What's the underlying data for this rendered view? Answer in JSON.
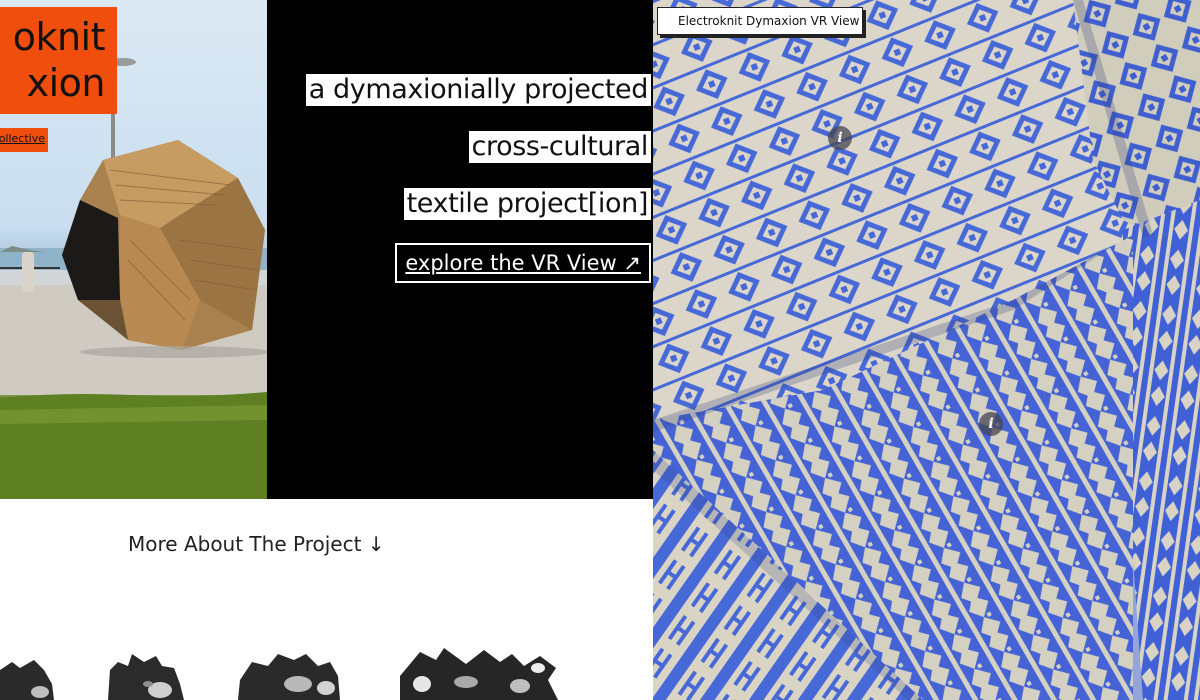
{
  "hero": {
    "title_line1": "oknit",
    "title_line2": "xion",
    "collective_link": "collective"
  },
  "statement": {
    "line1": "a dymaxionially projected",
    "line2": "cross-cultural",
    "line3": "textile project[ion]",
    "vr_link": "explore the VR View ↗"
  },
  "more_about": "More About The Project ↓",
  "vr_view": {
    "label": "Electroknit Dymaxion VR View",
    "hotspot_icon": "info-icon",
    "hotspot_glyph": "i"
  },
  "colors": {
    "accent": "#f04e0c",
    "panel_black": "#000000",
    "textile_blue": "#3a5fd6",
    "textile_cream": "#d8d3c4"
  }
}
